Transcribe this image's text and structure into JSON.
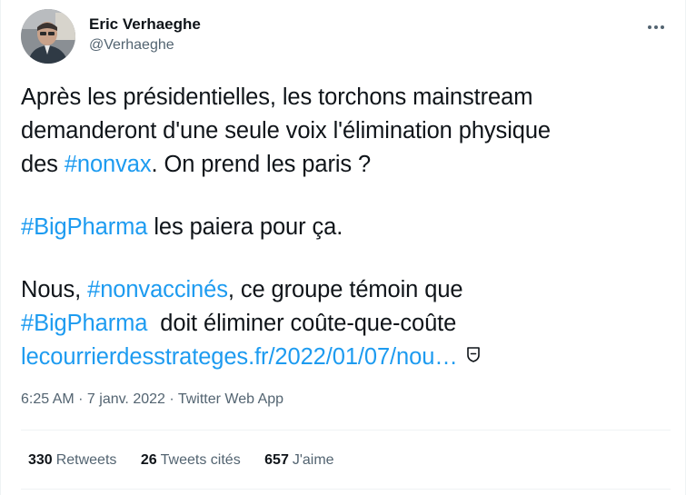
{
  "author": {
    "display_name": "Eric Verhaeghe",
    "handle": "@Verhaeghe"
  },
  "icons": {
    "more": "more-options-icon",
    "link_card": "link-card-icon",
    "avatar": "profile-photo"
  },
  "colors": {
    "accent": "#1d9bf0",
    "text": "#0f1419",
    "secondary": "#536471"
  },
  "tweet": {
    "line1": "Après les présidentielles, les torchons mainstream",
    "line2": "demanderont d'une seule voix l'élimination physique",
    "line3_pre": "des ",
    "line3_tag": "#nonvax",
    "line3_post": ". On prend les paris ?",
    "line4_tag": "#BigPharma",
    "line4_post": " les paiera pour ça.",
    "line5_pre": "Nous, ",
    "line5_tag": "#nonvaccinés",
    "line5_post": ", ce groupe témoin que",
    "line6_tag": "#BigPharma",
    "line6_post": "  doit éliminer coûte-que-coûte",
    "line7_link": "lecourrierdesstrateges.fr/2022/01/07/nou…"
  },
  "meta": {
    "time": "6:25 AM",
    "dot1": " · ",
    "date": "7 janv. 2022",
    "dot2": " · ",
    "source": "Twitter Web App"
  },
  "stats": {
    "retweets_count": "330",
    "retweets_label": "Retweets",
    "quotes_count": "26",
    "quotes_label": "Tweets cités",
    "likes_count": "657",
    "likes_label": "J'aime"
  }
}
